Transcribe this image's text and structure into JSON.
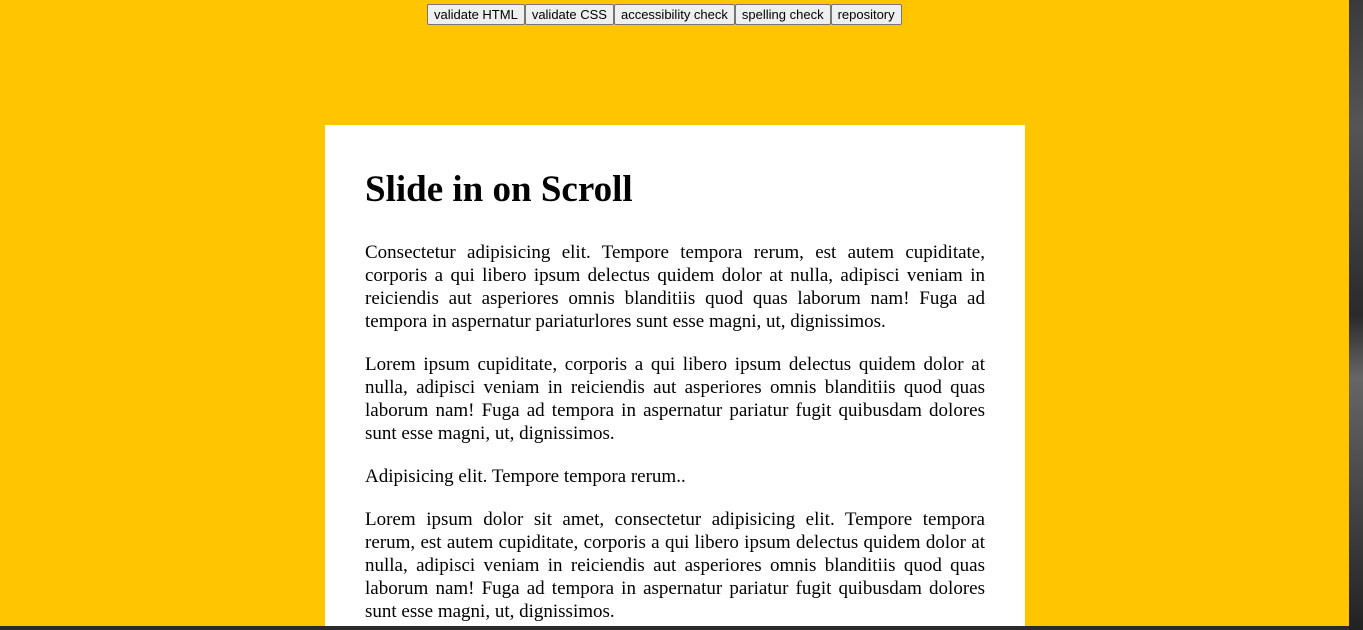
{
  "toolbar": {
    "buttons": [
      "validate HTML",
      "validate CSS",
      "accessibility check",
      "spelling check",
      "repository"
    ]
  },
  "colors": {
    "background": "#ffc600",
    "card": "#ffffff"
  },
  "article": {
    "title": "Slide in on Scroll",
    "paragraphs": [
      "Consectetur adipisicing elit. Tempore tempora rerum, est autem cupiditate, corporis a qui libero ipsum delectus quidem dolor at nulla, adipisci veniam in reiciendis aut asperiores omnis blanditiis quod quas laborum nam! Fuga ad tempora in aspernatur pariaturlores sunt esse magni, ut, dignissimos.",
      "Lorem ipsum cupiditate, corporis a qui libero ipsum delectus quidem dolor at nulla, adipisci veniam in reiciendis aut asperiores omnis blanditiis quod quas laborum nam! Fuga ad tempora in aspernatur pariatur fugit quibusdam dolores sunt esse magni, ut, dignissimos.",
      "Adipisicing elit. Tempore tempora rerum..",
      "Lorem ipsum dolor sit amet, consectetur adipisicing elit. Tempore tempora rerum, est autem cupiditate, corporis a qui libero ipsum delectus quidem dolor at nulla, adipisci veniam in reiciendis aut asperiores omnis blanditiis quod quas laborum nam! Fuga ad tempora in aspernatur pariatur fugit quibusdam dolores sunt esse magni, ut, dignissimos."
    ]
  }
}
